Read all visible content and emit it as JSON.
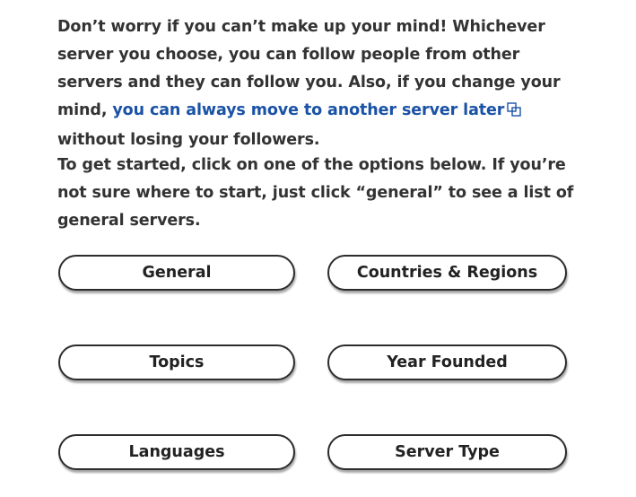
{
  "intro": {
    "part1": "Don’t worry if you can’t make up your mind! Whichever server you choose, you can follow people from other servers and they can follow you. Also, if you change your mind, ",
    "link_text": "you can always move to another server later",
    "link_icon": "external-link-icon",
    "part2": " without losing your followers."
  },
  "instructions": "To get started, click on one of the options below. If you’re not sure where to start, just click “general” to see a list of general servers.",
  "options": [
    "General",
    "Countries & Regions",
    "Topics",
    "Year Founded",
    "Languages",
    "Server Type"
  ],
  "colors": {
    "text": "#333333",
    "link": "#1a52a6",
    "button_border": "#2c2c2c"
  }
}
